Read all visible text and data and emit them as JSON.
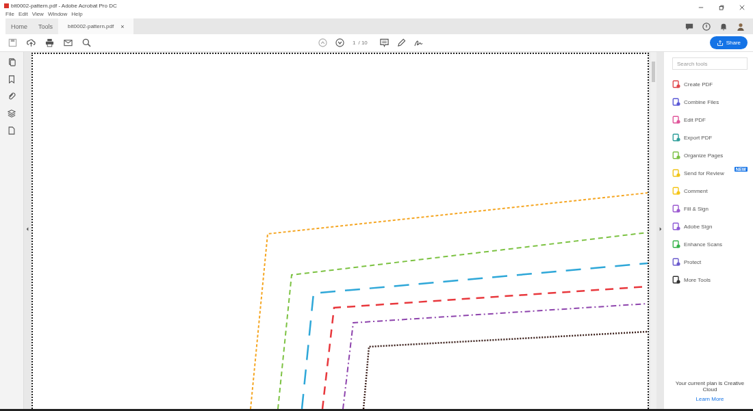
{
  "window": {
    "title": "bit0002-pattern.pdf - Adobe Acrobat Pro DC"
  },
  "menu": [
    "File",
    "Edit",
    "View",
    "Window",
    "Help"
  ],
  "tabs": [
    {
      "label": "Home",
      "selected": false,
      "kind": "nav"
    },
    {
      "label": "Tools",
      "selected": false,
      "kind": "nav"
    },
    {
      "label": "bit0002-pattern.pdf",
      "selected": true,
      "kind": "document",
      "close": "×"
    }
  ],
  "toolbar": {
    "page": "1",
    "page_total": "/ 10"
  },
  "share": {
    "label": "Share"
  },
  "tools_panel": {
    "search": {
      "placeholder": "Search tools"
    },
    "items": [
      {
        "label": "Create PDF",
        "color": "#e0474c"
      },
      {
        "label": "Combine Files",
        "color": "#5a58d6"
      },
      {
        "label": "Edit PDF",
        "color": "#e0559a"
      },
      {
        "label": "Export PDF",
        "color": "#2e9e9a"
      },
      {
        "label": "Organize Pages",
        "color": "#7bc043"
      },
      {
        "label": "Send for Review",
        "color": "#f0c419",
        "badge": "NEW"
      },
      {
        "label": "Comment",
        "color": "#f5c518"
      },
      {
        "label": "Fill & Sign",
        "color": "#9b59d0"
      },
      {
        "label": "Adobe Sign",
        "color": "#8e5bd6"
      },
      {
        "label": "Enhance Scans",
        "color": "#36b34a"
      },
      {
        "label": "Protect",
        "color": "#6a5acd"
      },
      {
        "label": "More Tools",
        "color": "#333333"
      }
    ],
    "plan_text": "Your current plan is Creative Cloud",
    "link": "Learn More"
  }
}
